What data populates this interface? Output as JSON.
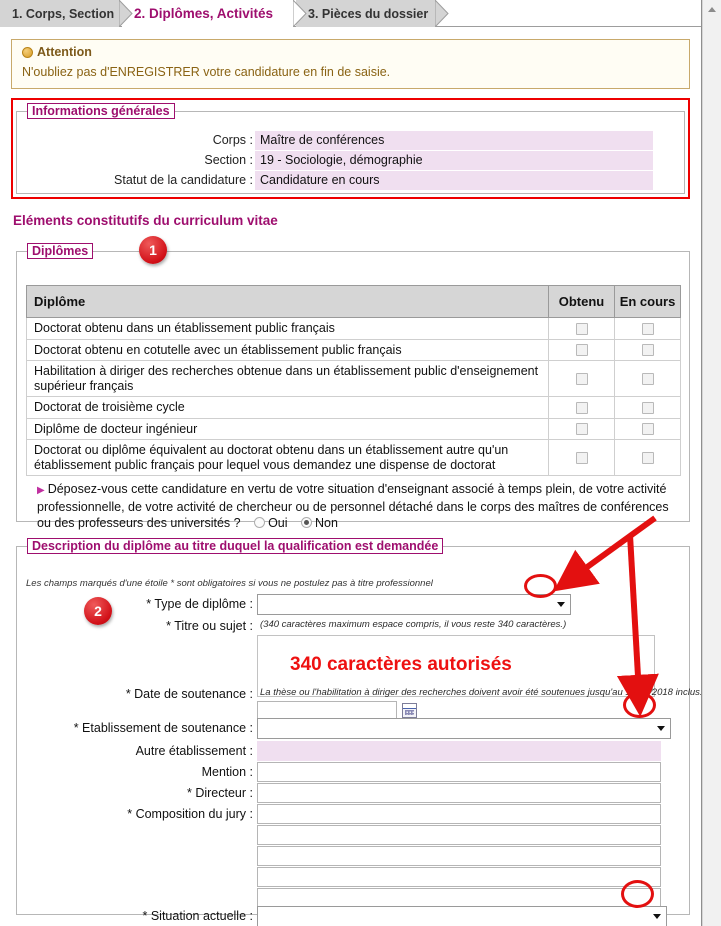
{
  "tabs": [
    {
      "label": "1. Corps, Section",
      "active": false
    },
    {
      "label": "2. Diplômes, Activités",
      "active": true
    },
    {
      "label": "3. Pièces du dossier",
      "active": false
    }
  ],
  "attention": {
    "icon": "warning-icon",
    "title": "Attention",
    "message": "N'oubliez pas d'ENREGISTRER votre candidature en fin de saisie."
  },
  "infos_generales": {
    "legend": "Informations générales",
    "rows": [
      {
        "label": "Corps :",
        "value": "Maître de conférences"
      },
      {
        "label": "Section :",
        "value": "19 - Sociologie, démographie"
      },
      {
        "label": "Statut de la candidature :",
        "value": "Candidature en cours"
      }
    ]
  },
  "cv_heading": "Eléments constitutifs du curriculum vitae",
  "diplomes": {
    "legend": "Diplômes",
    "columns": [
      "Diplôme",
      "Obtenu",
      "En cours"
    ],
    "rows": [
      {
        "label": "Doctorat obtenu dans un établissement public français",
        "obtenu": false,
        "en_cours": false
      },
      {
        "label": "Doctorat obtenu en cotutelle avec un établissement public français",
        "obtenu": false,
        "en_cours": false
      },
      {
        "label": "Habilitation à diriger des recherches obtenue dans un établissement public d'enseignement supérieur français",
        "obtenu": false,
        "en_cours": false
      },
      {
        "label": "Doctorat de troisième cycle",
        "obtenu": false,
        "en_cours": false
      },
      {
        "label": "Diplôme de docteur ingénieur",
        "obtenu": false,
        "en_cours": false
      },
      {
        "label": "Doctorat ou diplôme équivalent au doctorat obtenu dans un établissement autre qu'un établissement public français pour lequel vous demandez une dispense de doctorat",
        "obtenu": false,
        "en_cours": false
      }
    ],
    "question": "Déposez-vous cette candidature en vertu de votre situation d'enseignant associé à temps plein, de votre activité professionnelle, de votre activité de chercheur ou de personnel détaché dans le corps des maîtres de conférences ou des professeurs des universités ?",
    "option_oui": "Oui",
    "option_non": "Non",
    "selected": "Non"
  },
  "description": {
    "legend": "Description du diplôme au titre duquel la qualification est demandée",
    "note": "Les champs marqués d'une étoile * sont obligatoires si vous ne postulez pas à titre professionnel",
    "fields": {
      "type_diplome": {
        "label": "* Type de diplôme :",
        "value": "",
        "control": "select"
      },
      "titre_sujet": {
        "label": "* Titre ou sujet :",
        "hint": "(340 caractères maximum espace compris, il vous reste 340 caractères.)",
        "value": "",
        "overlay_text": "340 caractères autorisés"
      },
      "date_soutenance": {
        "label": "* Date de soutenance :",
        "hint": "La thèse ou l'habilitation à diriger des recherches doivent avoir été soutenues jusqu'au 18/12/2018 inclus.",
        "value": ""
      },
      "etablissement_soutenance": {
        "label": "* Etablissement de soutenance :",
        "value": "",
        "control": "select"
      },
      "autre_etablissement": {
        "label": "Autre établissement :",
        "value": ""
      },
      "mention": {
        "label": "Mention :",
        "value": ""
      },
      "directeur": {
        "label": "* Directeur :",
        "value": ""
      },
      "composition_jury": {
        "label": "* Composition du jury :",
        "value": "",
        "extra_lines": 5
      },
      "situation_actuelle": {
        "label": "* Situation actuelle :",
        "value": "",
        "control": "select"
      }
    }
  },
  "annotations": {
    "badges": [
      {
        "number": "1"
      },
      {
        "number": "2"
      }
    ],
    "accent_color": "#e31010",
    "brand_color": "#9e0e6e"
  },
  "scrollbar": {
    "up_icon": "scroll-up-arrow-icon"
  }
}
